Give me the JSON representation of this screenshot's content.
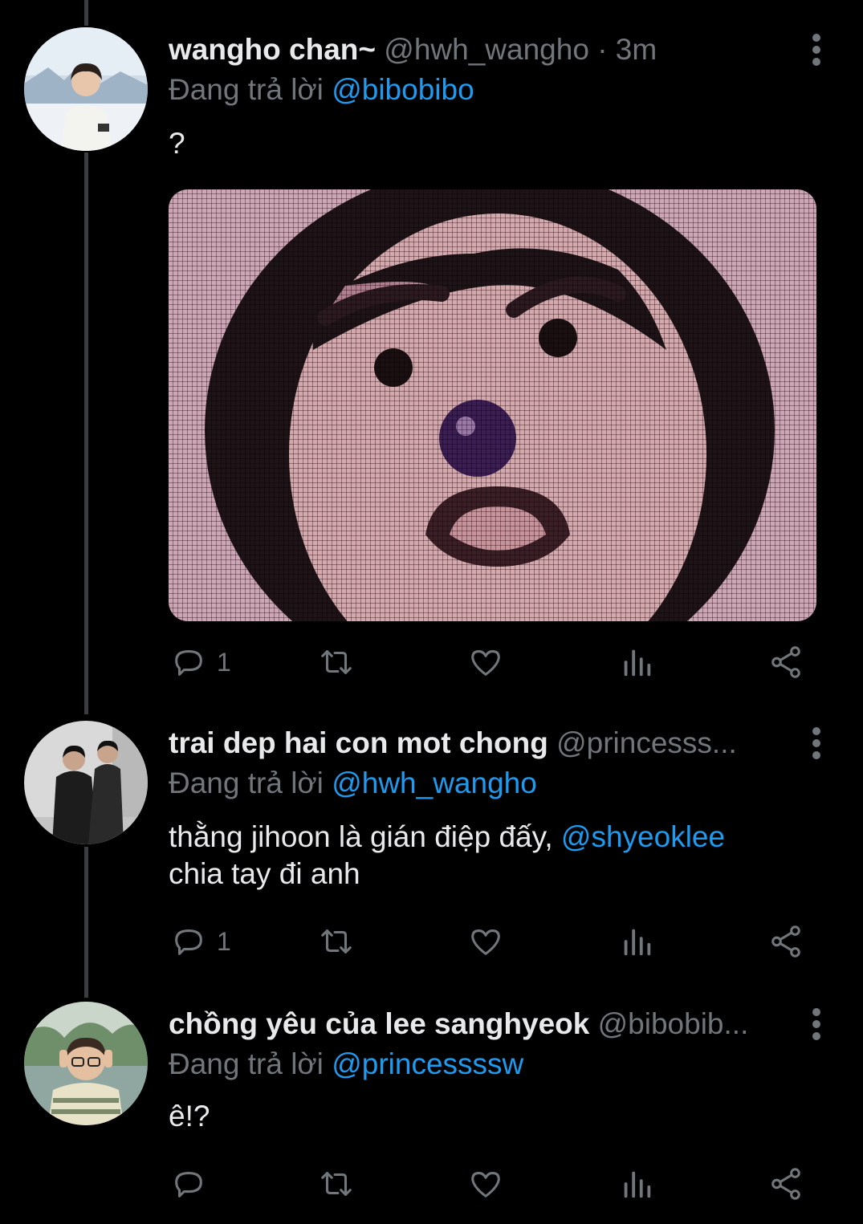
{
  "tweets": [
    {
      "name": "wangho chan~",
      "handle": "@hwh_wangho",
      "time": "· 3m",
      "replying_prefix": "Đang trả lời",
      "replying_to": "@bibobibo",
      "text": "?",
      "reply_count": "1"
    },
    {
      "name": "trai dep hai con mot chong",
      "handle": "@princesss...",
      "replying_prefix": "Đang trả lời",
      "replying_to": "@hwh_wangho",
      "text_part1": "thằng jihoon là gián điệp đấy, ",
      "text_mention": "@shyeoklee",
      "text_part2": "chia tay đi anh",
      "reply_count": "1"
    },
    {
      "name": "chồng yêu của lee sanghyeok",
      "handle": "@bibobib...",
      "replying_prefix": "Đang trả lời",
      "replying_to": "@princessssw",
      "text": "ê!?",
      "reply_count": ""
    }
  ],
  "icons": [
    "reply-icon",
    "retweet-icon",
    "like-icon",
    "views-icon",
    "share-icon",
    "more-icon"
  ],
  "colors": {
    "background": "#000000",
    "text": "#e7e9ea",
    "muted": "#71767b",
    "mention": "#1d9bf0"
  }
}
